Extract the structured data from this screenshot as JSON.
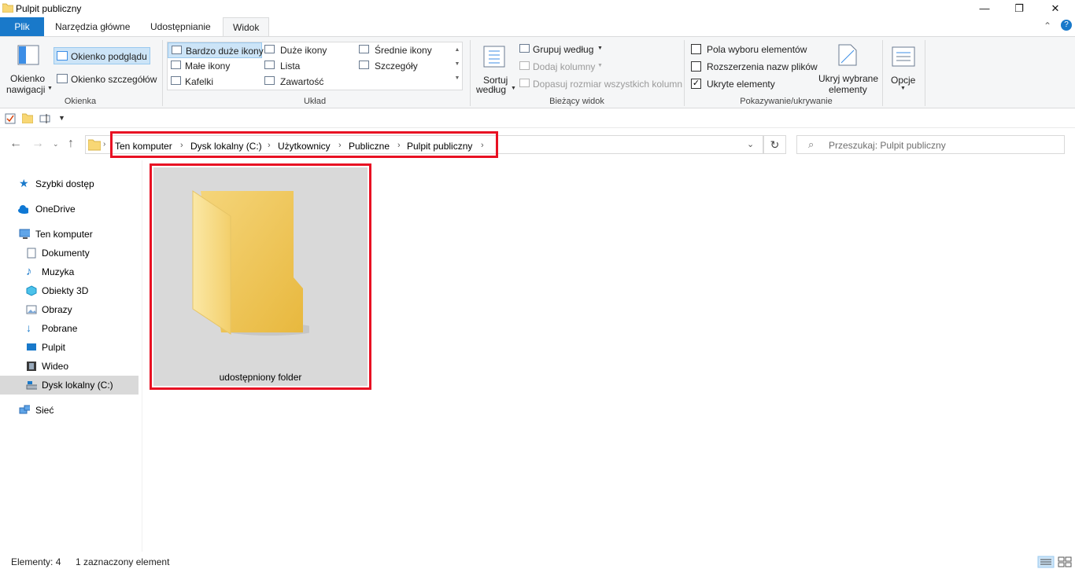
{
  "window": {
    "title": "Pulpit publiczny",
    "minimize_glyph": "—",
    "restore_glyph": "❐",
    "close_glyph": "✕"
  },
  "ribbon_tabs": {
    "file": "Plik",
    "tools": "Narzędzia główne",
    "share": "Udostępnianie",
    "view": "Widok",
    "help_glyph": "?",
    "collapse_glyph": "⌃"
  },
  "ribbon": {
    "panes": {
      "nav_pane_line1": "Okienko",
      "nav_pane_line2": "nawigacji",
      "preview_pane": "Okienko podglądu",
      "details_pane": "Okienko szczegółów",
      "group_label": "Okienka"
    },
    "layout": {
      "extra_large_icons": "Bardzo duże ikony",
      "large_icons": "Duże ikony",
      "medium_icons": "Średnie ikony",
      "small_icons": "Małe ikony",
      "list": "Lista",
      "details": "Szczegóły",
      "tiles": "Kafelki",
      "content": "Zawartość",
      "group_label": "Układ"
    },
    "current_view": {
      "sort_line1": "Sortuj",
      "sort_line2": "według",
      "group_by": "Grupuj według",
      "add_columns": "Dodaj kolumny",
      "size_columns": "Dopasuj rozmiar wszystkich kolumn",
      "group_label": "Bieżący widok"
    },
    "show_hide": {
      "item_checkboxes": "Pola wyboru elementów",
      "item_checkboxes_checked": false,
      "file_extensions": "Rozszerzenia nazw plików",
      "file_extensions_checked": false,
      "hidden_items": "Ukryte elementy",
      "hidden_items_checked": true,
      "hide_selected_line1": "Ukryj wybrane",
      "hide_selected_line2": "elementy",
      "group_label": "Pokazywanie/ukrywanie"
    },
    "options": {
      "label": "Opcje"
    }
  },
  "address": {
    "crumbs": [
      "Ten komputer",
      "Dysk lokalny (C:)",
      "Użytkownicy",
      "Publiczne",
      "Pulpit publiczny"
    ],
    "search_placeholder": "Przeszukaj: Pulpit publiczny"
  },
  "nav_pane": {
    "quick_access": "Szybki dostęp",
    "onedrive": "OneDrive",
    "this_pc": "Ten komputer",
    "documents": "Dokumenty",
    "music": "Muzyka",
    "objects3d": "Obiekty 3D",
    "pictures": "Obrazy",
    "downloads": "Pobrane",
    "desktop": "Pulpit",
    "videos": "Wideo",
    "local_disk": "Dysk lokalny (C:)",
    "network": "Sieć"
  },
  "content": {
    "items": [
      {
        "name": "udostępniony folder",
        "type": "folder",
        "selected": true
      }
    ]
  },
  "status": {
    "item_count": "Elementy: 4",
    "selected_count": "1 zaznaczony element"
  },
  "colors": {
    "accent": "#1979ca",
    "highlight": "#e81123",
    "selection": "#d9d9d9",
    "folder": "#f8d775"
  }
}
